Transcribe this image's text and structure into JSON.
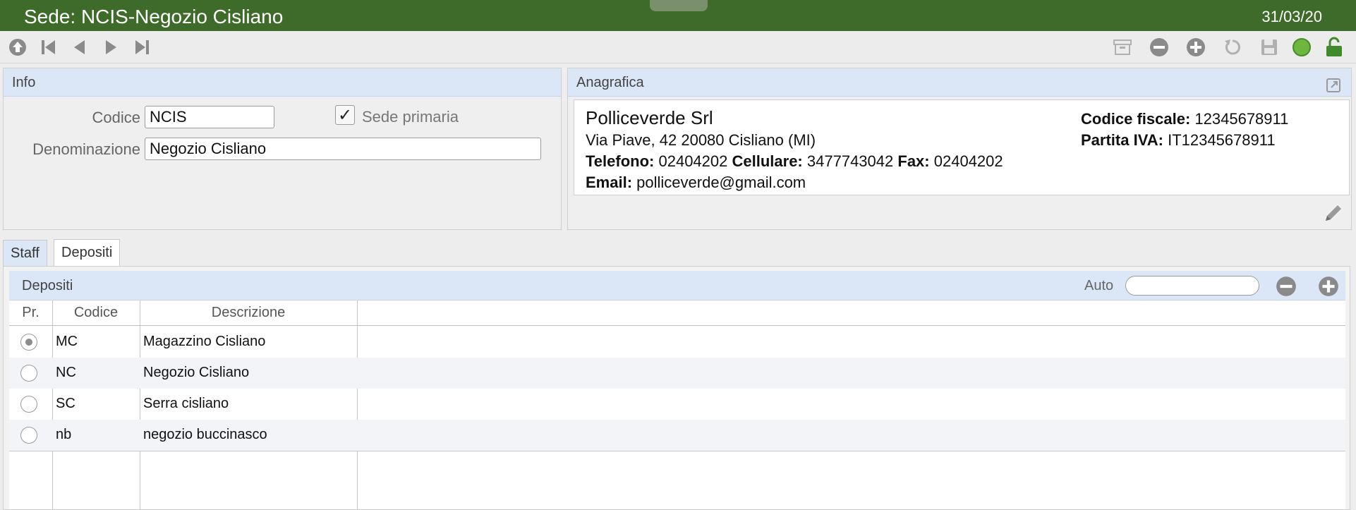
{
  "window": {
    "title": "Sede: NCIS-Negozio Cisliano",
    "date": "31/03/20"
  },
  "toolbar": {
    "nav": [
      "home-icon",
      "first-record-icon",
      "previous-record-icon",
      "next-record-icon",
      "last-record-icon"
    ],
    "actions": [
      "archive-icon",
      "delete-icon",
      "add-icon",
      "undo-icon",
      "save-icon",
      "status-light-icon",
      "unlock-icon"
    ],
    "colors": {
      "status_light": "#6db63f",
      "unlock": "#3f8a2b",
      "icon_gray": "#8a8a8a"
    }
  },
  "info": {
    "header": "Info",
    "codice_label": "Codice",
    "codice_value": "NCIS",
    "sede_primaria_label": "Sede primaria",
    "sede_primaria_checked": "✓",
    "denominazione_label": "Denominazione",
    "denominazione_value": "Negozio Cisliano"
  },
  "anagrafica": {
    "header": "Anagrafica",
    "company": "Polliceverde Srl",
    "address": "Via Piave, 42 20080 Cisliano (MI)",
    "telefono_label": "Telefono:",
    "telefono": "02404202",
    "cellulare_label": "Cellulare:",
    "cellulare": "3477743042",
    "fax_label": "Fax:",
    "fax": "02404202",
    "email_label": "Email:",
    "email": "polliceverde@gmail.com",
    "cf_label": "Codice fiscale:",
    "cf": "12345678911",
    "piva_label": "Partita IVA:",
    "piva": "IT12345678911"
  },
  "tabs": [
    {
      "label": "Staff"
    },
    {
      "label": "Depositi"
    }
  ],
  "depositi": {
    "title": "Depositi",
    "auto_label": "Auto",
    "search_value": "",
    "columns": [
      "Pr.",
      "Codice",
      "Descrizione"
    ],
    "rows": [
      {
        "primary": true,
        "codice": "MC",
        "descrizione": "Magazzino Cisliano"
      },
      {
        "primary": false,
        "codice": "NC",
        "descrizione": "Negozio Cisliano"
      },
      {
        "primary": false,
        "codice": "SC",
        "descrizione": "Serra cisliano"
      },
      {
        "primary": false,
        "codice": "nb",
        "descrizione": "negozio buccinasco"
      }
    ]
  }
}
